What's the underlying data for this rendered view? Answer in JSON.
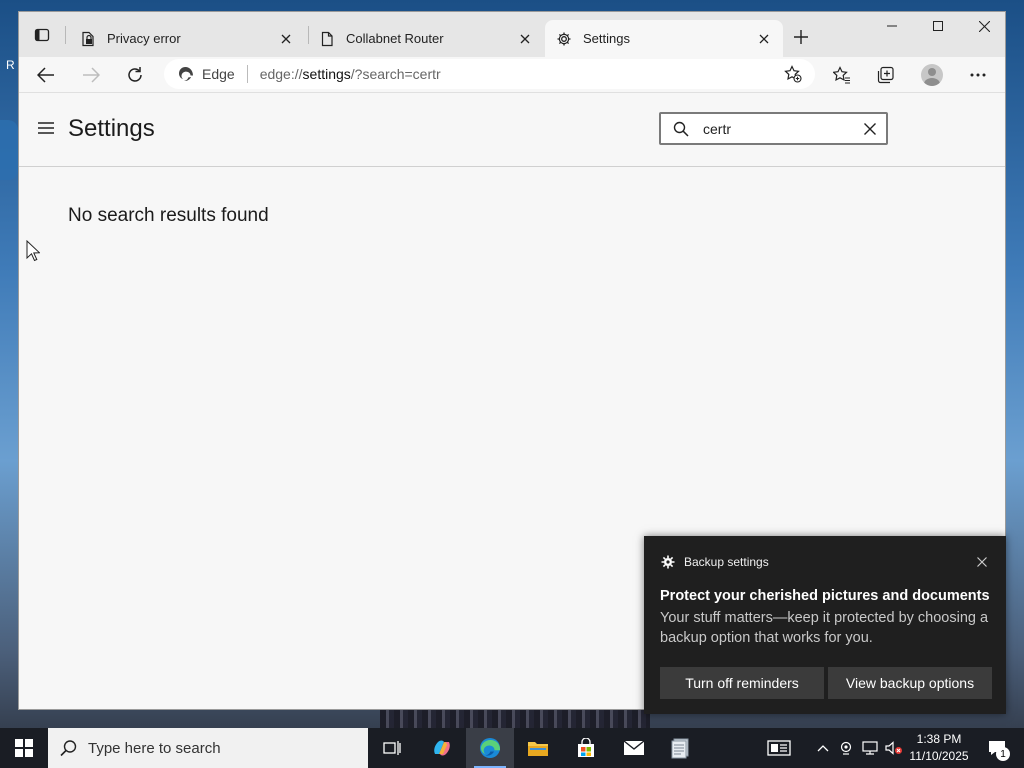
{
  "desktop": {
    "edge_letter": "R"
  },
  "browser": {
    "tabs": [
      {
        "label": "Privacy error",
        "icon": "lock-page-icon",
        "active": false
      },
      {
        "label": "Collabnet Router",
        "icon": "page-icon",
        "active": false
      },
      {
        "label": "Settings",
        "icon": "gear-icon",
        "active": true
      }
    ],
    "address": {
      "site_label": "Edge",
      "url_prefix": "edge://",
      "url_host": "settings",
      "url_rest": "/?search=certr"
    }
  },
  "settings": {
    "title": "Settings",
    "search": {
      "value": "certr",
      "placeholder": "Search settings"
    },
    "empty_message": "No search results found"
  },
  "toast": {
    "app_name": "Backup settings",
    "title": "Protect your cherished pictures and documents",
    "body": "Your stuff matters—keep it protected by choosing a backup option that works for you.",
    "primary_button": "Turn off reminders",
    "secondary_button": "View backup options"
  },
  "taskbar": {
    "search_placeholder": "Type here to search",
    "time": "1:38 PM",
    "date": "11/10/2025",
    "notification_count": "1"
  },
  "colors": {
    "accent": "#0078d4",
    "toast_bg": "#1f1f1f",
    "taskbar_bg": "#1a1d24"
  }
}
